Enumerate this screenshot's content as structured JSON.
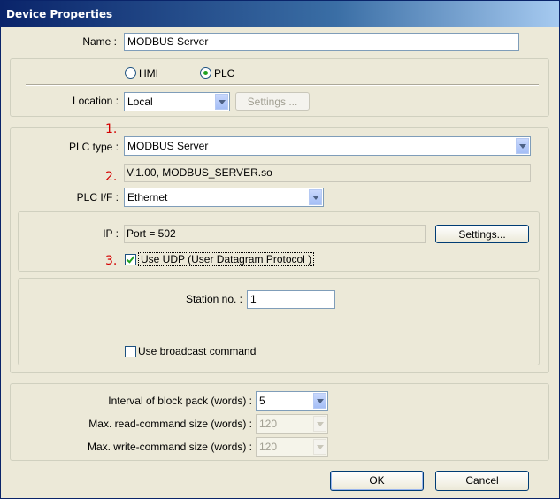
{
  "window": {
    "title": "Device Properties"
  },
  "name": {
    "label": "Name :",
    "value": "MODBUS Server"
  },
  "device_type": {
    "hmi": "HMI",
    "plc": "PLC",
    "selected": "PLC"
  },
  "location": {
    "label": "Location :",
    "value": "Local",
    "settings_button": "Settings ..."
  },
  "markers": [
    "1.",
    "2.",
    "3."
  ],
  "plc_type": {
    "label": "PLC type :",
    "value": "MODBUS Server"
  },
  "driver_info": "V.1.00, MODBUS_SERVER.so",
  "plc_if": {
    "label": "PLC I/F :",
    "value": "Ethernet"
  },
  "ip": {
    "label": "IP :",
    "value": "Port = 502",
    "settings_button": "Settings..."
  },
  "use_udp": {
    "label": "Use UDP (User Datagram Protocol )",
    "checked": true
  },
  "station": {
    "label": "Station no. :",
    "value": "1"
  },
  "broadcast": {
    "label": "Use broadcast command",
    "checked": false
  },
  "block_pack": {
    "label": "Interval of block pack (words) :",
    "value": "5"
  },
  "max_read": {
    "label": "Max. read-command size (words) :",
    "value": "120"
  },
  "max_write": {
    "label": "Max. write-command size (words) :",
    "value": "120"
  },
  "buttons": {
    "ok": "OK",
    "cancel": "Cancel"
  },
  "colors": {
    "marker": "#d40000",
    "title_bar": "#0a246a",
    "dialog_bg": "#ece9d8"
  }
}
